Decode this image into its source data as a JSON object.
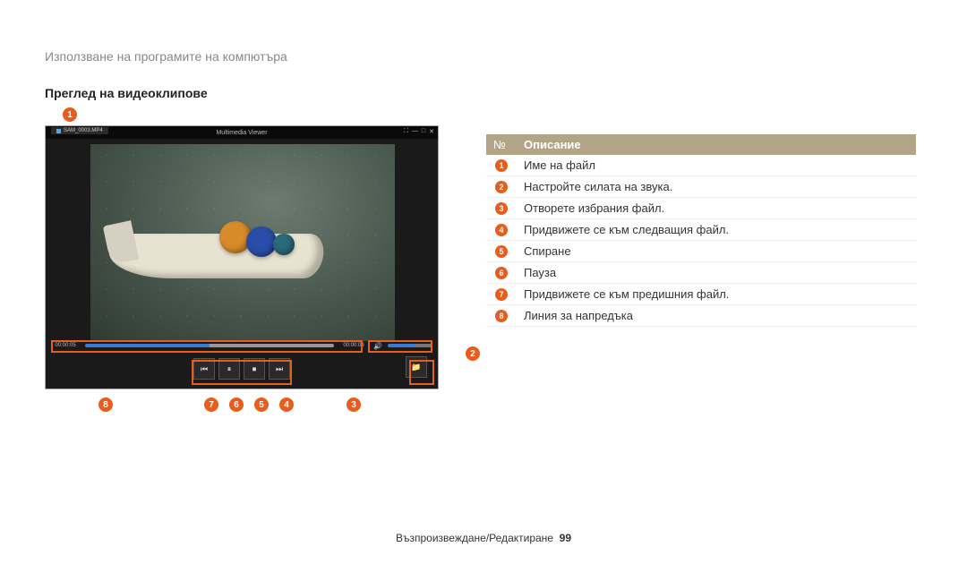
{
  "breadcrumb": "Използване на програмите на компютъра",
  "section_title": "Преглед на видеоклипове",
  "player": {
    "file_tab": "SAM_0003.MP4",
    "title": "Multimedia Viewer",
    "time_current": "00:00:05",
    "time_total": "00:00:09",
    "controls": {
      "prev": "⏮",
      "pause": "⏸",
      "stop": "⏹",
      "next": "⏭",
      "folder": "📁",
      "vol": "🔊"
    },
    "win": {
      "minimize": "—",
      "maximize": "□",
      "close": "✕",
      "full": "⛶"
    }
  },
  "callouts": {
    "c1": "1",
    "c2": "2",
    "c3": "3",
    "c4": "4",
    "c5": "5",
    "c6": "6",
    "c7": "7",
    "c8": "8"
  },
  "legend": {
    "header_num": "№",
    "header_desc": "Описание",
    "rows": [
      {
        "num": "1",
        "desc": "Име на файл"
      },
      {
        "num": "2",
        "desc": "Настройте силата на звука."
      },
      {
        "num": "3",
        "desc": "Отворете избрания файл."
      },
      {
        "num": "4",
        "desc": "Придвижете се към следващия файл."
      },
      {
        "num": "5",
        "desc": "Спиране"
      },
      {
        "num": "6",
        "desc": "Пауза"
      },
      {
        "num": "7",
        "desc": "Придвижете се към предишния файл."
      },
      {
        "num": "8",
        "desc": "Линия за напредъка"
      }
    ]
  },
  "footer": {
    "text": "Възпроизвеждане/Редактиране",
    "page": "99"
  }
}
